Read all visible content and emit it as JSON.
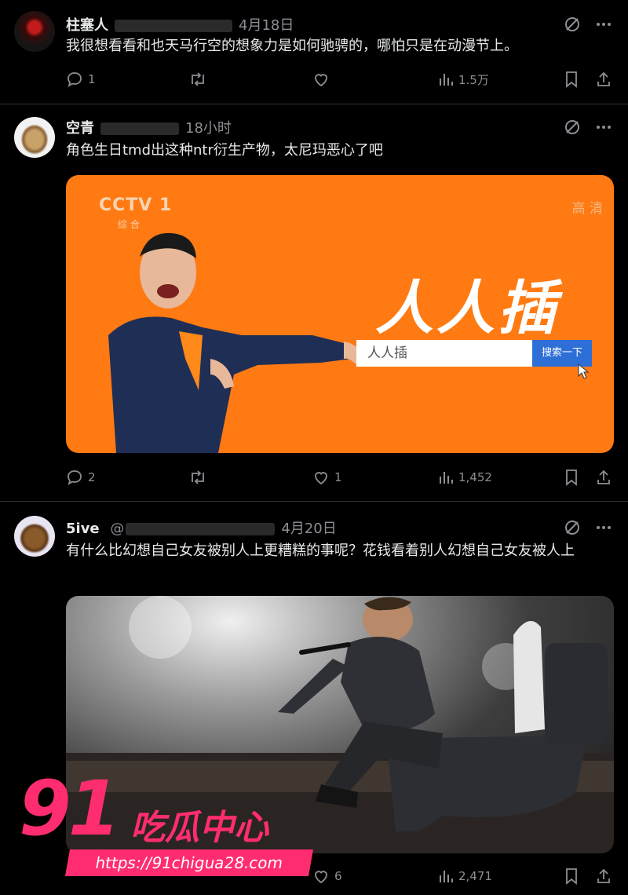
{
  "posts": [
    {
      "name": "柱塞人",
      "date": "4月18日",
      "text": "我很想看看和也天马行空的想象力是如何驰骋的，哪怕只是在动漫节上。",
      "replies": "1",
      "retweets": "",
      "likes": "",
      "views": "1.5万"
    },
    {
      "name": "空青",
      "date": "18小时",
      "text": "角色生日tmd出这种ntr衍生产物，太尼玛恶心了吧",
      "replies": "2",
      "retweets": "",
      "likes": "1",
      "views": "1,452",
      "media": {
        "logo": "CCTV 1",
        "logo_sub": "综 合",
        "hd": "高 清",
        "headline": "人人插",
        "search_text": "人人插",
        "search_button": "搜索一下"
      }
    },
    {
      "name": "5ive",
      "handle_prefix": "@",
      "date": "4月20日",
      "text": "有什么比幻想自己女友被别人上更糟糕的事呢？花钱看着别人幻想自己女友被人上",
      "replies": "",
      "retweets": "",
      "likes": "6",
      "views": "2,471"
    }
  ],
  "watermark": {
    "number": "91",
    "title": "吃瓜中心",
    "url": "https://91chigua28.com"
  },
  "colors": {
    "background": "#000000",
    "text": "#e7e9ea",
    "muted": "#8b8f94",
    "orange": "#ff7a12",
    "watermark": "#ff2d6f"
  },
  "icons": [
    "grok-icon",
    "more-icon",
    "reply-icon",
    "retweet-icon",
    "like-icon",
    "views-icon",
    "bookmark-icon",
    "share-icon"
  ]
}
